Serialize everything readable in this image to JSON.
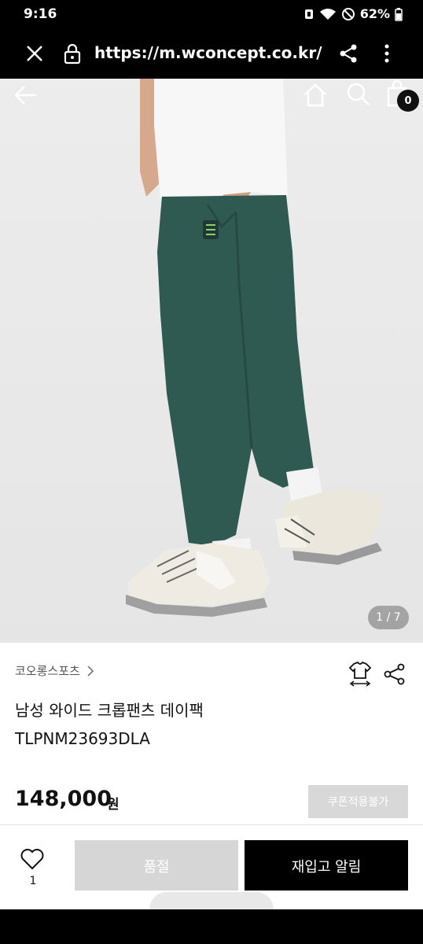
{
  "status_bar": {
    "time": "9:16",
    "battery": "62%"
  },
  "browser": {
    "url": "https://m.wconcept.co.kr/Pr"
  },
  "header": {
    "cart_count": "0"
  },
  "gallery": {
    "page_indicator": "1 / 7"
  },
  "product": {
    "brand": "코오롱스포츠",
    "name": "남성 와이드 크롭팬츠 데이팩",
    "code": "TLPNM23693DLA",
    "price": "148,000",
    "price_unit": "원",
    "coupon_label": "쿠폰적용불가"
  },
  "bottom_bar": {
    "like_count": "1",
    "soldout_label": "품절",
    "restock_label": "재입고 알림"
  },
  "colors": {
    "pants": "#2f5a52",
    "accent": "#000000",
    "disabled": "#d6d6d6"
  },
  "icons": [
    "close-icon",
    "lock-icon",
    "share-icon",
    "more-vert-icon",
    "back-arrow-icon",
    "home-icon",
    "search-icon",
    "shopping-bag-icon",
    "fit-size-icon",
    "heart-icon",
    "chevron-right-icon"
  ]
}
